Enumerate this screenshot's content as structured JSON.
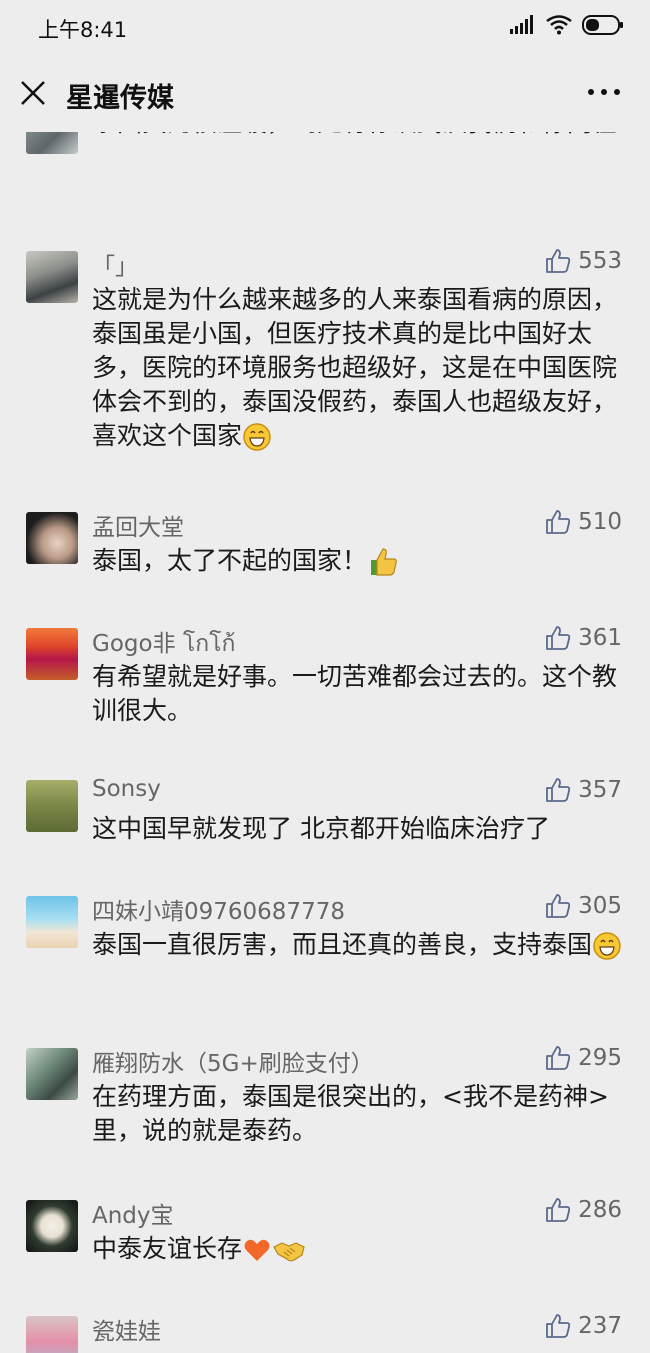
{
  "status_bar": {
    "time": "上午8:41"
  },
  "nav": {
    "title": "星暹传媒"
  },
  "comments": [
    {
      "username": "",
      "likes": "",
      "text": "泰国真的很温暖，到处有标识武汉我们和你同在"
    },
    {
      "username": "「」",
      "likes": "553",
      "text": "这就是为什么越来越多的人来泰国看病的原因，泰国虽是小国，但医疗技术真的是比中国好太多，医院的环境服务也超级好，这是在中国医院体会不到的，泰国没假药，泰国人也超级友好，喜欢这个国家"
    },
    {
      "username": "孟回大堂",
      "likes": "510",
      "text": "泰国，太了不起的国家！"
    },
    {
      "username": "Gogo非 โกโก้",
      "likes": "361",
      "text": "有希望就是好事。一切苦难都会过去的。这个教训很大。"
    },
    {
      "username": "Sonsy",
      "likes": "357",
      "text": "这中国早就发现了 北京都开始临床治疗了"
    },
    {
      "username": "四妹小靖09760687778",
      "likes": "305",
      "text": "泰国一直很厉害，而且还真的善良，支持泰国"
    },
    {
      "username": "雁翔防水（5G+刷脸支付）",
      "likes": "295",
      "text": "在药理方面，泰国是很突出的，<我不是药神>里，说的就是泰药。"
    },
    {
      "username": "Andy宝",
      "likes": "286",
      "text": "中泰友谊长存"
    },
    {
      "username": "瓷娃娃",
      "likes": "237",
      "text": ""
    }
  ]
}
